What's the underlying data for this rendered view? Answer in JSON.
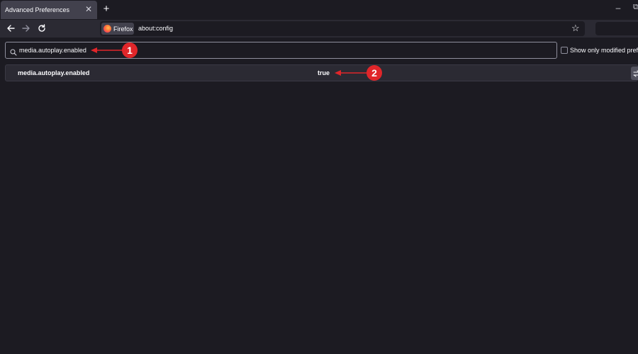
{
  "tab": {
    "title": "Advanced Preferences",
    "close_glyph": "✕"
  },
  "window": {
    "new_tab_glyph": "+",
    "minimize_glyph": "–",
    "restore_glyph": "⧉"
  },
  "nav": {
    "back_icon": "back-arrow-icon",
    "forward_icon": "forward-arrow-icon",
    "reload_icon": "reload-icon",
    "identity_label": "Firefox",
    "url": "about:config",
    "bookmark_glyph": "☆"
  },
  "search": {
    "value": "media.autoplay.enabled",
    "icon": "search-icon"
  },
  "modified_only": {
    "label": "Show only modified preferences",
    "checked": false
  },
  "preference": {
    "name": "media.autoplay.enabled",
    "value": "true",
    "toggle_icon": "toggle-icon"
  },
  "annotations": [
    {
      "number": "1"
    },
    {
      "number": "2"
    }
  ],
  "colors": {
    "background": "#1c1b22",
    "toolbar": "#2b2a33",
    "active_tab": "#42414d",
    "callout": "#e0262a",
    "text": "#fbfbfe"
  }
}
